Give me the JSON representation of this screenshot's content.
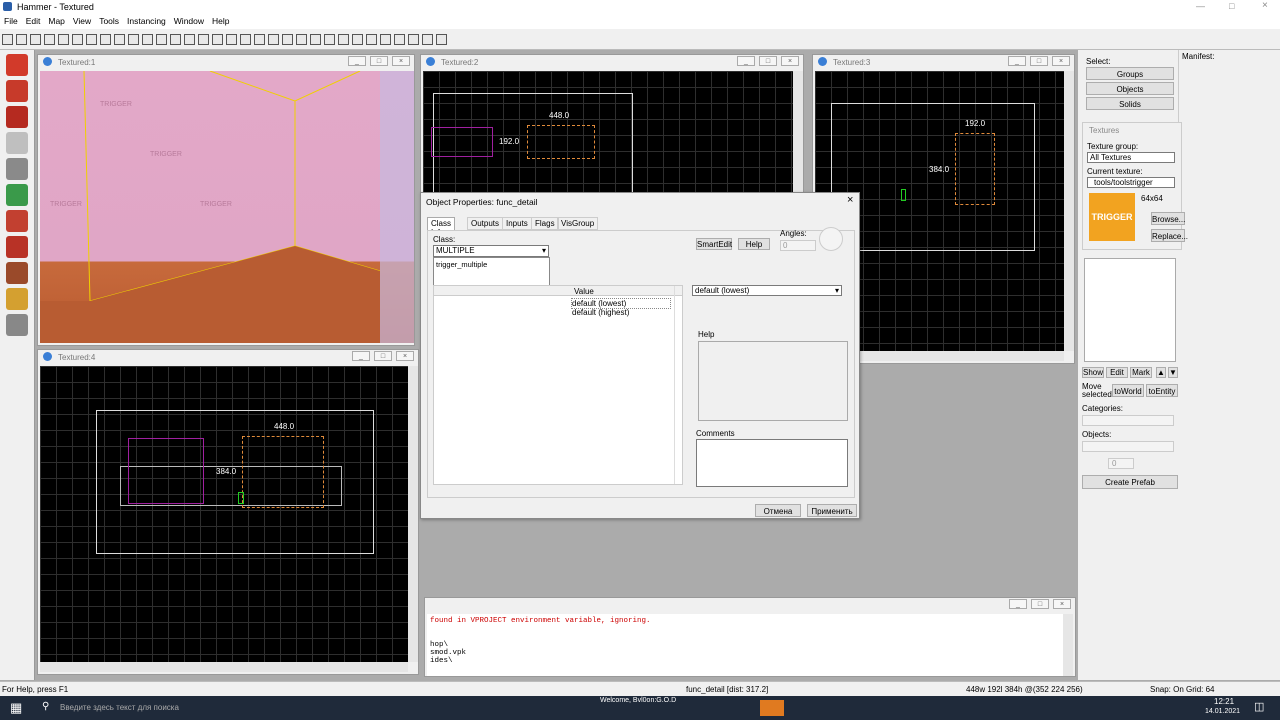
{
  "app": {
    "title": "Hammer - Textured"
  },
  "menu": [
    "File",
    "Edit",
    "Map",
    "View",
    "Tools",
    "Instancing",
    "Window",
    "Help"
  ],
  "viewports": {
    "v1": {
      "title": "Textured:1"
    },
    "v2": {
      "title": "Textured:2",
      "width_label": "448.0",
      "height_label": "192.0"
    },
    "v3": {
      "title": "Textured:3",
      "width_label": "192.0",
      "height_label": "384.0"
    },
    "v4": {
      "title": "Textured:4",
      "width_label": "448.0",
      "height_label": "384.0"
    }
  },
  "texture_text": "TRIGGER",
  "dialog": {
    "title": "Object Properties: func_detail",
    "tabs": [
      "Class Info",
      "Outputs",
      "Inputs",
      "Flags",
      "VisGroup"
    ],
    "class_label": "Class:",
    "class_value": "MULTIPLE",
    "dropdown_items": [
      "trigger_multiple"
    ],
    "smartedit": "SmartEdit",
    "help_btn": "Help",
    "angles_label": "Angles:",
    "angles_value": "0",
    "col_value": "Value",
    "rows": [
      "default (lowest)",
      "default (highest)"
    ],
    "value_combo": "default (lowest)",
    "help_label": "Help",
    "comments_label": "Comments",
    "cancel": "Отмена",
    "apply": "Применить"
  },
  "right": {
    "select_label": "Select:",
    "groups": "Groups",
    "objects": "Objects",
    "solids": "Solids",
    "manifest": "Manifest:",
    "textures_title": "Textures",
    "texture_group_label": "Texture group:",
    "texture_group": "All Textures",
    "current_texture_label": "Current texture:",
    "current_texture": "tools/toolstrigger",
    "size": "64x64",
    "browse": "Browse...",
    "replace": "Replace...",
    "show": "Show",
    "edit": "Edit",
    "mark": "Mark",
    "move_selected": "Move selected",
    "toworld": "toWorld",
    "toentity": "toEntity",
    "categories": "Categories:",
    "objects_label": "Objects:",
    "num": "0",
    "create_prefab": "Create Prefab"
  },
  "console": {
    "lines": [
      "found in VPROJECT environment variable, ignoring.",
      "",
      "",
      "hop\\",
      "smod.vpk",
      "ides\\"
    ]
  },
  "status": {
    "help": "For Help, press F1",
    "object": "func_detail  [dist: 317.2]",
    "size": "448w 192l 384h @(352 224 256)",
    "snap": "Snap: On Grid: 64"
  },
  "taskbar": {
    "search": "Введите здесь текст для поиска",
    "welcome": "Welcome, Bvl0on:G.O.D",
    "time": "12:21",
    "date": "14.01.2021"
  }
}
